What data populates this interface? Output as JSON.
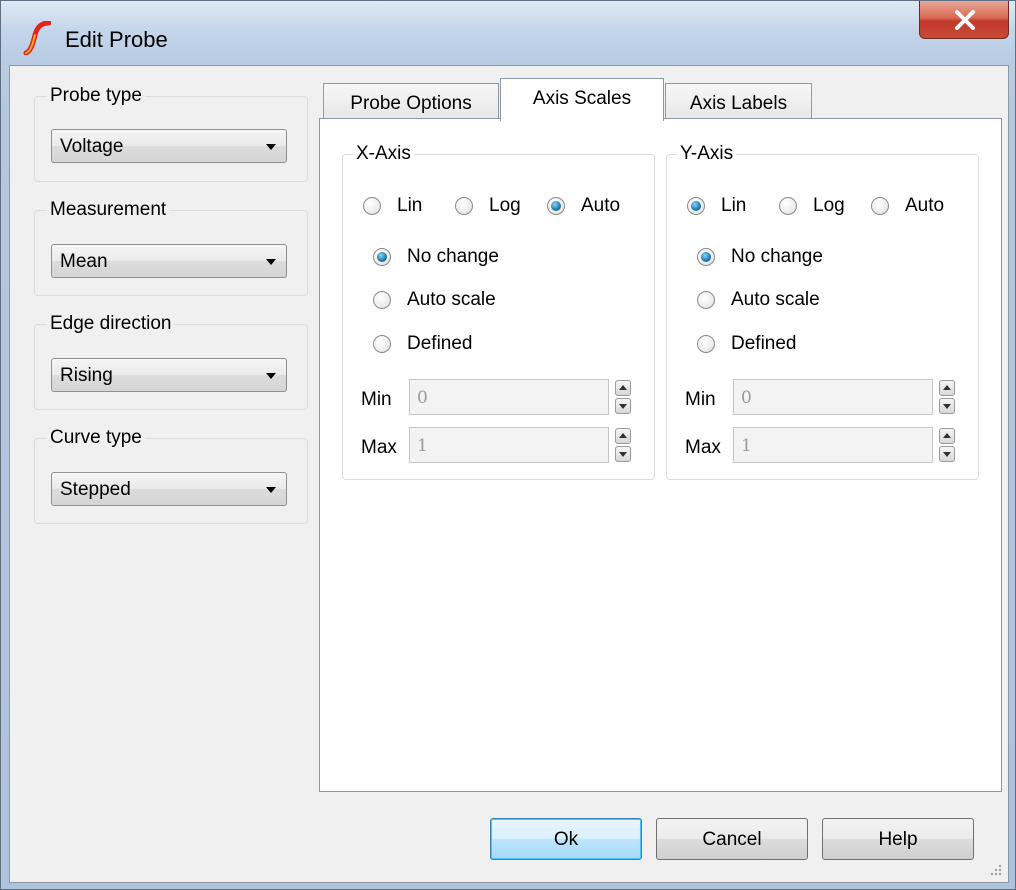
{
  "window": {
    "title": "Edit Probe",
    "logo_icon": "simetrix-logo-icon",
    "close_icon": "close-icon"
  },
  "left_panel": {
    "probe_type": {
      "title": "Probe type",
      "value": "Voltage"
    },
    "measurement": {
      "title": "Measurement",
      "value": "Mean"
    },
    "edge_direction": {
      "title": "Edge direction",
      "value": "Rising"
    },
    "curve_type": {
      "title": "Curve type",
      "value": "Stepped"
    }
  },
  "tabs": [
    {
      "label": "Probe Options",
      "active": false
    },
    {
      "label": "Axis Scales",
      "active": true
    },
    {
      "label": "Axis Labels",
      "active": false
    }
  ],
  "x_axis": {
    "title": "X-Axis",
    "scale_options": [
      {
        "label": "Lin",
        "checked": false
      },
      {
        "label": "Log",
        "checked": false
      },
      {
        "label": "Auto",
        "checked": true
      }
    ],
    "range_options": [
      {
        "label": "No change",
        "checked": true
      },
      {
        "label": "Auto scale",
        "checked": false
      },
      {
        "label": "Defined",
        "checked": false
      }
    ],
    "min_label": "Min",
    "min_value": "0",
    "max_label": "Max",
    "max_value": "1"
  },
  "y_axis": {
    "title": "Y-Axis",
    "scale_options": [
      {
        "label": "Lin",
        "checked": true
      },
      {
        "label": "Log",
        "checked": false
      },
      {
        "label": "Auto",
        "checked": false
      }
    ],
    "range_options": [
      {
        "label": "No change",
        "checked": true
      },
      {
        "label": "Auto scale",
        "checked": false
      },
      {
        "label": "Defined",
        "checked": false
      }
    ],
    "min_label": "Min",
    "min_value": "0",
    "max_label": "Max",
    "max_value": "1"
  },
  "buttons": {
    "ok": "Ok",
    "cancel": "Cancel",
    "help": "Help"
  },
  "colors": {
    "radio_selected": "#1f7fb5",
    "close_button": "#c94a35",
    "default_button_border": "#3c7fb1"
  }
}
